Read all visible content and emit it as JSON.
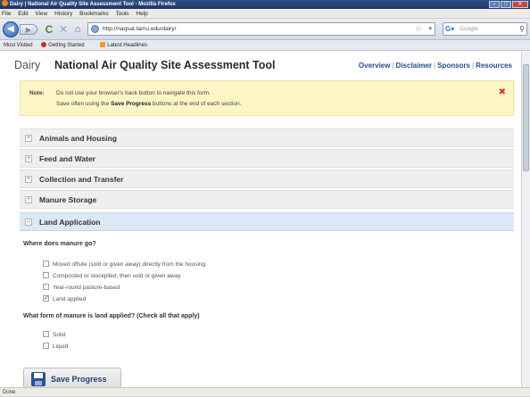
{
  "window": {
    "title": "Dairy | National Air Quality Site Assessment Tool - Mozilla Firefox"
  },
  "menu": [
    "File",
    "Edit",
    "View",
    "History",
    "Bookmarks",
    "Tools",
    "Help"
  ],
  "nav": {
    "url": "http://naqsat.tamu.edu/dairy/",
    "search_placeholder": "Google"
  },
  "bookmarks": [
    {
      "label": "Most Visited",
      "icon": "none"
    },
    {
      "label": "Getting Started",
      "icon": "firefox-icon"
    },
    {
      "label": "Latest Headlines",
      "icon": "rss-icon"
    }
  ],
  "header": {
    "dairy": "Dairy",
    "title": "National Air Quality Site Assessment Tool",
    "links": [
      "Overview",
      "Disclaimer",
      "Sponsors",
      "Resources"
    ]
  },
  "note": {
    "label": "Note:",
    "line1": "Do not use your browser's back button to navigate this form.",
    "line2_pre": "Save often using the ",
    "line2_bold": "Save Progress",
    "line2_post": " buttons at the end of each section."
  },
  "sections": [
    {
      "label": "Animals and Housing"
    },
    {
      "label": "Feed and Water"
    },
    {
      "label": "Collection and Transfer"
    },
    {
      "label": "Manure Storage"
    },
    {
      "label": "Land Application"
    }
  ],
  "q1": {
    "question": "Where does manure go?",
    "options": [
      {
        "label": "Moved offsite (sold or given away) directly from the housing",
        "checked": false
      },
      {
        "label": "Composted or stockpiled, then sold or given away",
        "checked": false
      },
      {
        "label": "Year-round pasture-based",
        "checked": false
      },
      {
        "label": "Land applied",
        "checked": true
      }
    ]
  },
  "q2": {
    "question": "What form of manure is land applied? (Check all that apply)",
    "options": [
      {
        "label": "Solid",
        "checked": false
      },
      {
        "label": "Liquid",
        "checked": false
      }
    ]
  },
  "save": {
    "label": "Save Progress"
  },
  "status": {
    "text": "Done"
  }
}
